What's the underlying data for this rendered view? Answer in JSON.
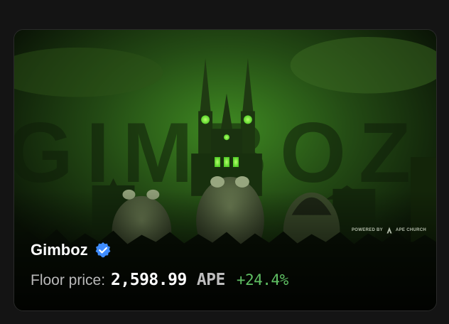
{
  "collection": {
    "name": "Gimboz",
    "verified": true,
    "floor_label": "Floor price:",
    "floor_value": "2,598.99",
    "currency": "APE",
    "change": "+24.4%",
    "banner_text": "GIMBOZ",
    "powered_by": "POWERED BY",
    "powered_brand": "APE CHURCH"
  },
  "colors": {
    "background": "#141414",
    "banner_tint": "#2e6a1c",
    "positive": "#5fbf63",
    "verified_badge": "#3f8cff"
  },
  "icons": {
    "verified": "verified-badge-icon",
    "brand": "ape-church-logo-icon"
  }
}
